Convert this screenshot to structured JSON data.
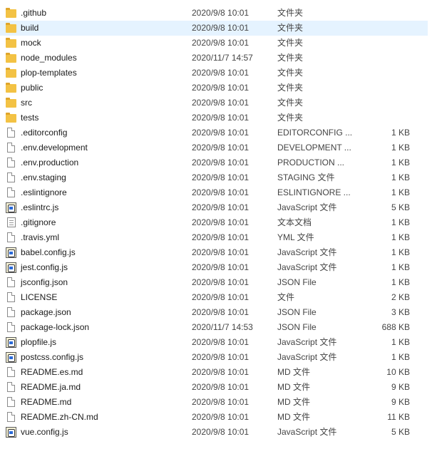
{
  "files": [
    {
      "name": ".github",
      "date": "2020/9/8 10:01",
      "type": "文件夹",
      "size": "",
      "icon": "folder-icon"
    },
    {
      "name": "build",
      "date": "2020/9/8 10:01",
      "type": "文件夹",
      "size": "",
      "icon": "folder-icon",
      "selected": true
    },
    {
      "name": "mock",
      "date": "2020/9/8 10:01",
      "type": "文件夹",
      "size": "",
      "icon": "folder-icon"
    },
    {
      "name": "node_modules",
      "date": "2020/11/7 14:57",
      "type": "文件夹",
      "size": "",
      "icon": "folder-icon"
    },
    {
      "name": "plop-templates",
      "date": "2020/9/8 10:01",
      "type": "文件夹",
      "size": "",
      "icon": "folder-icon"
    },
    {
      "name": "public",
      "date": "2020/9/8 10:01",
      "type": "文件夹",
      "size": "",
      "icon": "folder-icon"
    },
    {
      "name": "src",
      "date": "2020/9/8 10:01",
      "type": "文件夹",
      "size": "",
      "icon": "folder-icon"
    },
    {
      "name": "tests",
      "date": "2020/9/8 10:01",
      "type": "文件夹",
      "size": "",
      "icon": "folder-icon"
    },
    {
      "name": ".editorconfig",
      "date": "2020/9/8 10:01",
      "type": "EDITORCONFIG ...",
      "size": "1 KB",
      "icon": "file-icon"
    },
    {
      "name": ".env.development",
      "date": "2020/9/8 10:01",
      "type": "DEVELOPMENT ...",
      "size": "1 KB",
      "icon": "file-icon"
    },
    {
      "name": ".env.production",
      "date": "2020/9/8 10:01",
      "type": "PRODUCTION ...",
      "size": "1 KB",
      "icon": "file-icon"
    },
    {
      "name": ".env.staging",
      "date": "2020/9/8 10:01",
      "type": "STAGING 文件",
      "size": "1 KB",
      "icon": "file-icon"
    },
    {
      "name": ".eslintignore",
      "date": "2020/9/8 10:01",
      "type": "ESLINTIGNORE ...",
      "size": "1 KB",
      "icon": "file-icon"
    },
    {
      "name": ".eslintrc.js",
      "date": "2020/9/8 10:01",
      "type": "JavaScript 文件",
      "size": "5 KB",
      "icon": "js-icon"
    },
    {
      "name": ".gitignore",
      "date": "2020/9/8 10:01",
      "type": "文本文档",
      "size": "1 KB",
      "icon": "textdoc-icon"
    },
    {
      "name": ".travis.yml",
      "date": "2020/9/8 10:01",
      "type": "YML 文件",
      "size": "1 KB",
      "icon": "file-icon"
    },
    {
      "name": "babel.config.js",
      "date": "2020/9/8 10:01",
      "type": "JavaScript 文件",
      "size": "1 KB",
      "icon": "js-icon"
    },
    {
      "name": "jest.config.js",
      "date": "2020/9/8 10:01",
      "type": "JavaScript 文件",
      "size": "1 KB",
      "icon": "js-icon"
    },
    {
      "name": "jsconfig.json",
      "date": "2020/9/8 10:01",
      "type": "JSON File",
      "size": "1 KB",
      "icon": "file-icon"
    },
    {
      "name": "LICENSE",
      "date": "2020/9/8 10:01",
      "type": "文件",
      "size": "2 KB",
      "icon": "file-icon"
    },
    {
      "name": "package.json",
      "date": "2020/9/8 10:01",
      "type": "JSON File",
      "size": "3 KB",
      "icon": "file-icon"
    },
    {
      "name": "package-lock.json",
      "date": "2020/11/7 14:53",
      "type": "JSON File",
      "size": "688 KB",
      "icon": "file-icon"
    },
    {
      "name": "plopfile.js",
      "date": "2020/9/8 10:01",
      "type": "JavaScript 文件",
      "size": "1 KB",
      "icon": "js-icon"
    },
    {
      "name": "postcss.config.js",
      "date": "2020/9/8 10:01",
      "type": "JavaScript 文件",
      "size": "1 KB",
      "icon": "js-icon"
    },
    {
      "name": "README.es.md",
      "date": "2020/9/8 10:01",
      "type": "MD 文件",
      "size": "10 KB",
      "icon": "file-icon"
    },
    {
      "name": "README.ja.md",
      "date": "2020/9/8 10:01",
      "type": "MD 文件",
      "size": "9 KB",
      "icon": "file-icon"
    },
    {
      "name": "README.md",
      "date": "2020/9/8 10:01",
      "type": "MD 文件",
      "size": "9 KB",
      "icon": "file-icon"
    },
    {
      "name": "README.zh-CN.md",
      "date": "2020/9/8 10:01",
      "type": "MD 文件",
      "size": "11 KB",
      "icon": "file-icon"
    },
    {
      "name": "vue.config.js",
      "date": "2020/9/8 10:01",
      "type": "JavaScript 文件",
      "size": "5 KB",
      "icon": "js-icon"
    }
  ],
  "colors": {
    "selected_row": "#e5f3ff",
    "folder": "#f3c244"
  }
}
